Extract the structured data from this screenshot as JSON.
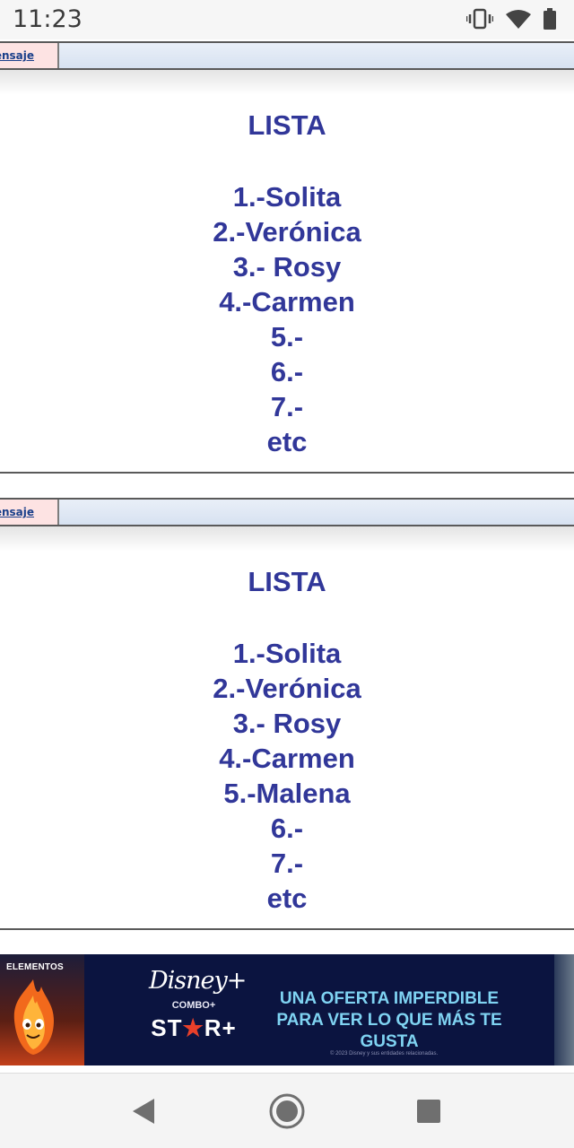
{
  "status_bar": {
    "time": "11:23",
    "icons": [
      "vibrate-icon",
      "wifi-icon",
      "battery-icon"
    ]
  },
  "posts": [
    {
      "msg_link": "ensaje",
      "title": "LISTA",
      "items": [
        "1.-Solita",
        "2.-Verónica",
        "3.- Rosy",
        "4.-Carmen",
        "5.-",
        "6.-",
        "7.-",
        "etc"
      ]
    },
    {
      "msg_link": "ensaje",
      "title": "LISTA",
      "items": [
        "1.-Solita",
        "2.-Verónica",
        "3.- Rosy",
        "4.-Carmen",
        "5.-Malena",
        "6.-",
        "7.-",
        "etc"
      ]
    }
  ],
  "ad": {
    "movie_label": "ELEMENTOS",
    "brand": "Disney+",
    "combo": "COMBO+",
    "star_plus": "ST★R+",
    "headline_line1": "UNA OFERTA IMPERDIBLE",
    "headline_line2": "PARA VER LO QUE MÁS TE GUSTA",
    "legal": "© 2023 Disney y sus entidades relacionadas."
  },
  "nav_bar": {
    "buttons": [
      "back-icon",
      "home-icon",
      "recents-icon"
    ]
  },
  "colors": {
    "list_text": "#313799",
    "ad_background": "#0b1440",
    "ad_headline": "#7fd3f2"
  }
}
